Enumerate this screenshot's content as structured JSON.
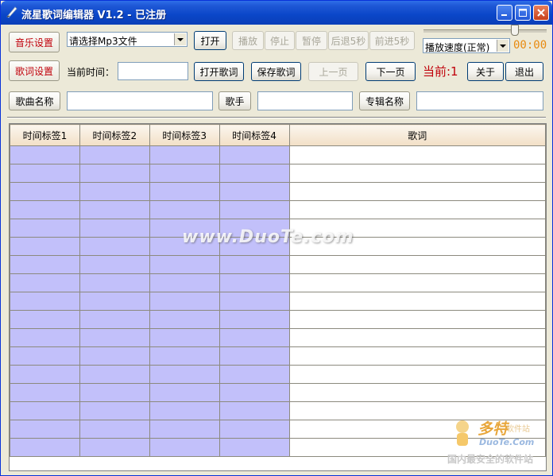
{
  "window": {
    "title": "流星歌词编辑器 V1.2 - 已注册"
  },
  "row1": {
    "music_settings": "音乐设置",
    "file_select": {
      "value": "请选择Mp3文件"
    },
    "open": "打开",
    "play": "播放",
    "stop": "停止",
    "pause": "暂停",
    "rewind": "后退5秒",
    "forward": "前进5秒",
    "speed": {
      "value": "播放速度(正常)"
    },
    "time": "00:00"
  },
  "row2": {
    "lyrics_settings": "歌词设置",
    "current_time_label": "当前时间：",
    "current_time_value": "",
    "open_lyrics": "打开歌词",
    "save_lyrics": "保存歌词",
    "prev_page": "上一页",
    "next_page": "下一页",
    "current": "当前:1",
    "about": "关于",
    "exit": "退出"
  },
  "row3": {
    "song_name": "歌曲名称",
    "singer": "歌手",
    "album": "专辑名称"
  },
  "table": {
    "columns": [
      "时间标签1",
      "时间标签2",
      "时间标签3",
      "时间标签4",
      "歌词"
    ]
  },
  "watermark": {
    "text": "www.DuoTe.com",
    "logo_cn": "多特",
    "logo_small": "软件站",
    "logo_en": "DuoTe.Com",
    "logo_site": "国内最安全的软件站"
  },
  "colors": {
    "accent_red": "#c0000a",
    "timestamp_cell": "#c2c0fa",
    "time_orange": "#e88a10"
  }
}
